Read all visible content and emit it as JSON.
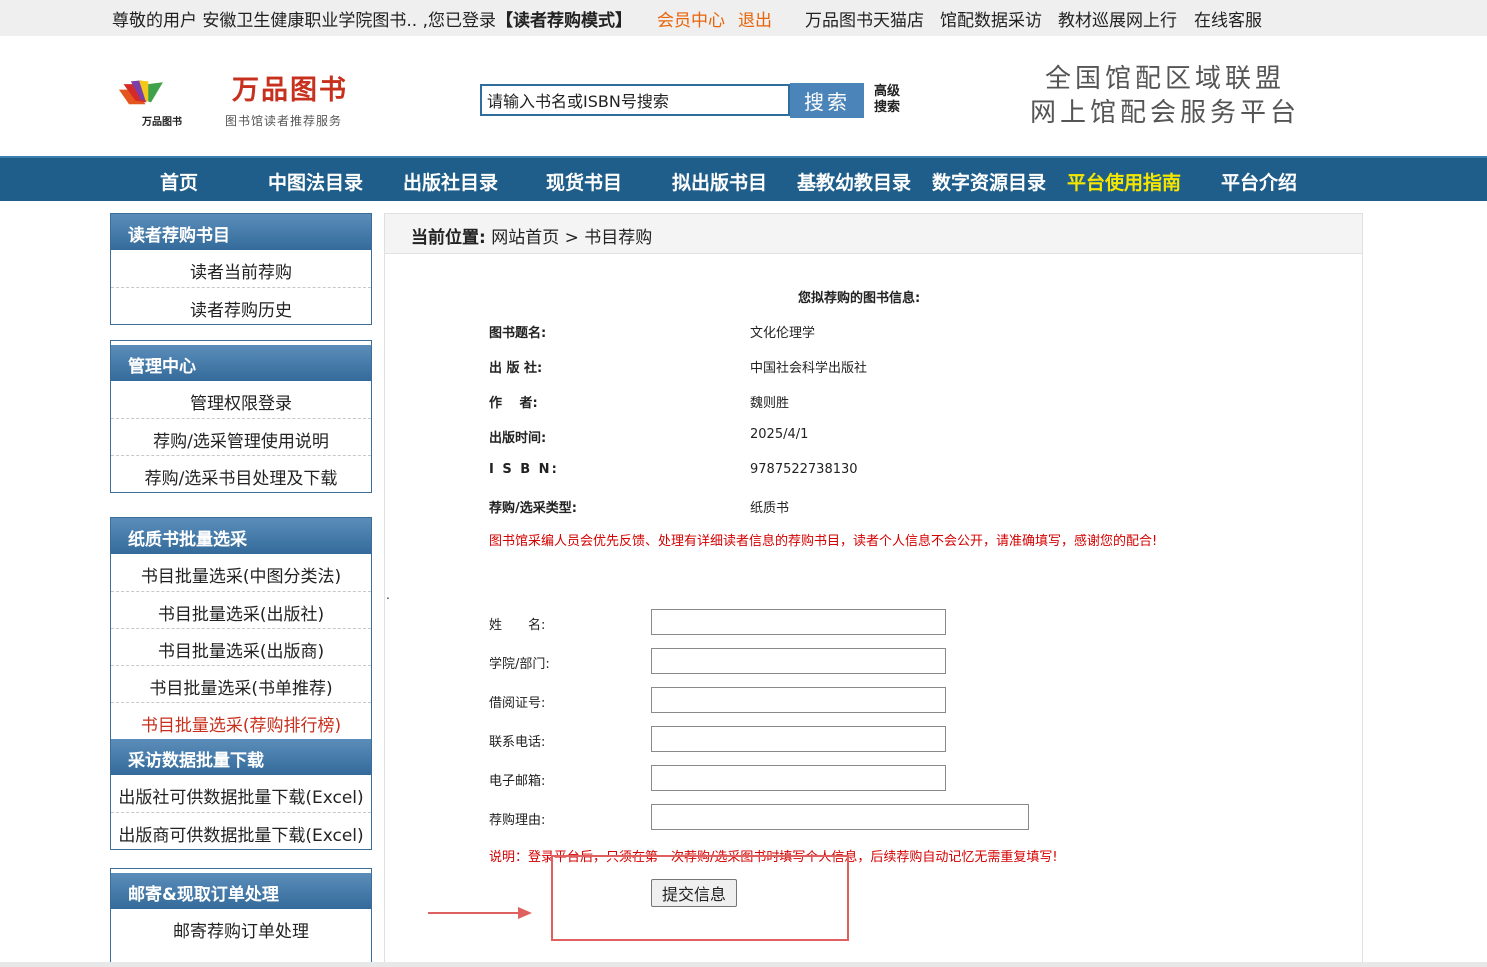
{
  "topbar": {
    "greeting": "尊敬的用户 安徽卫生健康职业学院图书.. ,您已登录",
    "mode": "【读者荐购模式】",
    "member_center": "会员中心",
    "logout": "退出",
    "links": [
      "万品图书天猫店",
      "馆配数据采访",
      "教材巡展网上行",
      "在线客服"
    ]
  },
  "header": {
    "logo_title": "万品图书",
    "logo_subtitle": "图书馆读者推荐服务",
    "logo_mark_text": "万品图书",
    "search_placeholder": "请输入书名或ISBN号搜索",
    "search_button": "搜索",
    "advanced_search": "高级搜索",
    "slogan_line1": "全国馆配区域联盟",
    "slogan_line2": "网上馆配会服务平台"
  },
  "nav": {
    "items": [
      "首页",
      "中图法目录",
      "出版社目录",
      "现货书目",
      "拟出版书目",
      "基教幼教目录",
      "数字资源目录",
      "平台使用指南",
      "平台介绍"
    ],
    "highlight_color": "#f5e600"
  },
  "sidebar": {
    "sections": [
      {
        "title": "读者荐购书目",
        "items": [
          "读者当前荐购",
          "读者荐购历史"
        ]
      },
      {
        "title": "管理中心",
        "items": [
          "管理权限登录",
          "荐购/选采管理使用说明",
          "荐购/选采书目处理及下载"
        ]
      },
      {
        "title": "纸质书批量选采",
        "items": [
          "书目批量选采(中图分类法)",
          "书目批量选采(出版社)",
          "书目批量选采(出版商)",
          "书目批量选采(书单推荐)",
          "书目批量选采(荐购排行榜)"
        ]
      },
      {
        "title": "采访数据批量下载",
        "items": [
          "出版社可供数据批量下载(Excel)",
          "出版商可供数据批量下载(Excel)"
        ]
      },
      {
        "title": "邮寄&现取订单处理",
        "items": [
          "邮寄荐购订单处理"
        ]
      }
    ]
  },
  "breadcrumb": {
    "label": "当前位置:",
    "path": "网站首页 > 书目荐购"
  },
  "book_info": {
    "title": "您拟荐购的图书信息:",
    "rows": [
      {
        "label": "图书题名:",
        "value": "文化伦理学"
      },
      {
        "label": "出 版 社:",
        "value": "中国社会科学出版社"
      },
      {
        "label": "作　 者:",
        "value": "魏则胜"
      },
      {
        "label": "出版时间:",
        "value": "2025/4/1"
      },
      {
        "label": "I S B N:",
        "value": "9787522738130"
      },
      {
        "label": "荐购/选采类型:",
        "value": "纸质书"
      }
    ],
    "notice": "图书馆采编人员会优先反馈、处理有详细读者信息的荐购书目，读者个人信息不会公开，请准确填写，感谢您的配合!"
  },
  "form": {
    "fields": [
      {
        "label": "姓　　名:",
        "value": ""
      },
      {
        "label": "学院/部门:",
        "value": ""
      },
      {
        "label": "借阅证号:",
        "value": ""
      },
      {
        "label": "联系电话:",
        "value": ""
      },
      {
        "label": "电子邮箱:",
        "value": ""
      },
      {
        "label": "荐购理由:",
        "value": ""
      }
    ],
    "note": "说明：登录平台后，只须在第一次荐购/选采图书时填写个人信息，后续荐购自动记忆无需重复填写!",
    "submit": "提交信息"
  },
  "colors": {
    "nav_bg": "#1f5e8a",
    "accent_orange": "#e8640a",
    "notice_red": "#d40000",
    "annotation_red": "#e06060"
  }
}
